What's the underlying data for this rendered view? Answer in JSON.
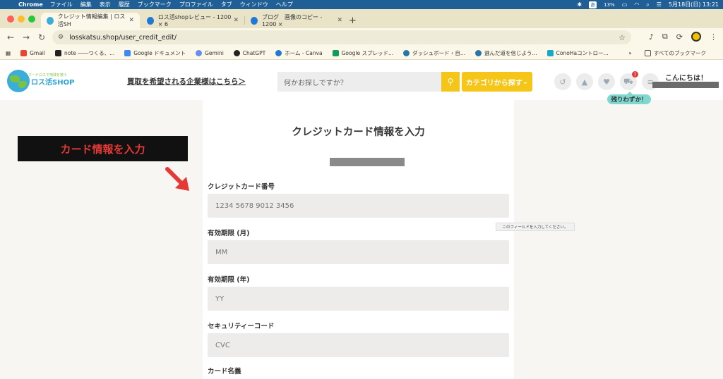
{
  "menubar": {
    "app": "Chrome",
    "items": [
      "ファイル",
      "編集",
      "表示",
      "履歴",
      "ブックマーク",
      "プロファイル",
      "タブ",
      "ウィンドウ",
      "ヘルプ"
    ],
    "input_method": "あ",
    "battery": "13%",
    "datetime": "5月18日(日) 13:21"
  },
  "tabs": [
    {
      "title": "クレジット情報編集 | ロス活SH",
      "active": true
    },
    {
      "title": "ロス活shopレビュー - 1200 × 6",
      "active": false
    },
    {
      "title": "ブログ　画像のコピー - 1200 ×",
      "active": false
    }
  ],
  "toolbar": {
    "url": "losskatsu.shop/user_credit_edit/"
  },
  "bookmarks": {
    "items": [
      "Gmail",
      "note ――つくる、...",
      "Google ドキュメント",
      "Gemini",
      "ChatGPT",
      "ホーム - Canva",
      "Google スプレッド...",
      "ダッシュボード ‹ 自...",
      "選んだ道を信じよう...",
      "ConoHaコントロー..."
    ],
    "all_bookmarks": "すべてのブックマーク"
  },
  "header": {
    "logo_text": "ロス活SHOP",
    "logo_sub": "フードロスで地球を救う",
    "corp_link": "買取を希望される企業様はこちら＞",
    "search_placeholder": "何かお探しですか？",
    "category_button": "カテゴリから探す",
    "cart_count": "1",
    "greeting": "こんにちは！",
    "balloon": "残りわずか！"
  },
  "annotation": {
    "label": "カード情報を入力"
  },
  "form": {
    "title": "クレジットカード情報を入力",
    "fields": [
      {
        "label": "クレジットカード番号",
        "placeholder": "1234 5678 9012 3456"
      },
      {
        "label": "有効期限 (月)",
        "placeholder": "MM"
      },
      {
        "label": "有効期限 (年)",
        "placeholder": "YY"
      },
      {
        "label": "セキュリティーコード",
        "placeholder": "CVC"
      },
      {
        "label": "カード名義",
        "placeholder": ""
      }
    ],
    "validation_tooltip": "このフィールドを入力してください。"
  },
  "colors": {
    "accent": "#f5c518",
    "menubar": "#1f5f95",
    "annotation_red": "#e53935"
  }
}
